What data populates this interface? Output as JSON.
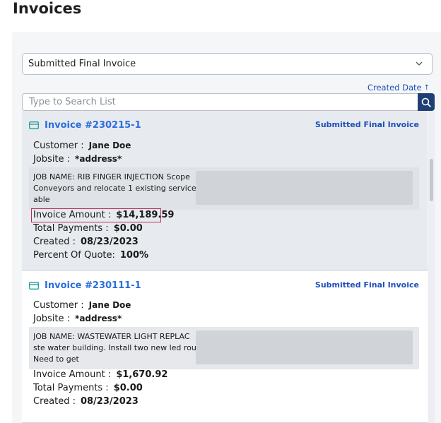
{
  "page": {
    "title": "Invoices"
  },
  "filter": {
    "selected": "Submitted Final Invoice"
  },
  "sort": {
    "label": "Created Date",
    "direction": "ascending"
  },
  "search": {
    "placeholder": "Type to Search List",
    "value": ""
  },
  "labels": {
    "customer": "Customer :",
    "jobsite": "Jobsite :",
    "invoice_amount": "Invoice Amount :",
    "total_payments": "Total Payments :",
    "created": "Created :",
    "percent_of_quote": "Percent Of Quote:"
  },
  "invoices": [
    {
      "number": "Invoice #230215-1",
      "status": "Submitted Final Invoice",
      "customer": "Jane Doe",
      "jobsite": "*address*",
      "job_lines": [
        "JOB NAME: RIB FINGER INJECTION Scope",
        "Conveyors and relocate 1 existing service",
        "able"
      ],
      "invoice_amount": "$14,189.59",
      "total_payments": "$0.00",
      "created": "08/23/2023",
      "percent_of_quote": "100%"
    },
    {
      "number": "Invoice #230111-1",
      "status": "Submitted Final Invoice",
      "customer": "Jane Doe",
      "jobsite": "*address*",
      "job_lines": [
        "JOB NAME: WASTEWATER LIGHT REPLAC",
        "ste water building. Install two new led rou",
        "Need to get"
      ],
      "invoice_amount": "$1,670.92",
      "total_payments": "$0.00",
      "created": "08/23/2023"
    }
  ],
  "colors": {
    "link": "#2b6de0",
    "status": "#1d4fb8",
    "highlight": "#b52e58",
    "search_button": "#1f3e74",
    "card_icon": "#1aa39a"
  }
}
